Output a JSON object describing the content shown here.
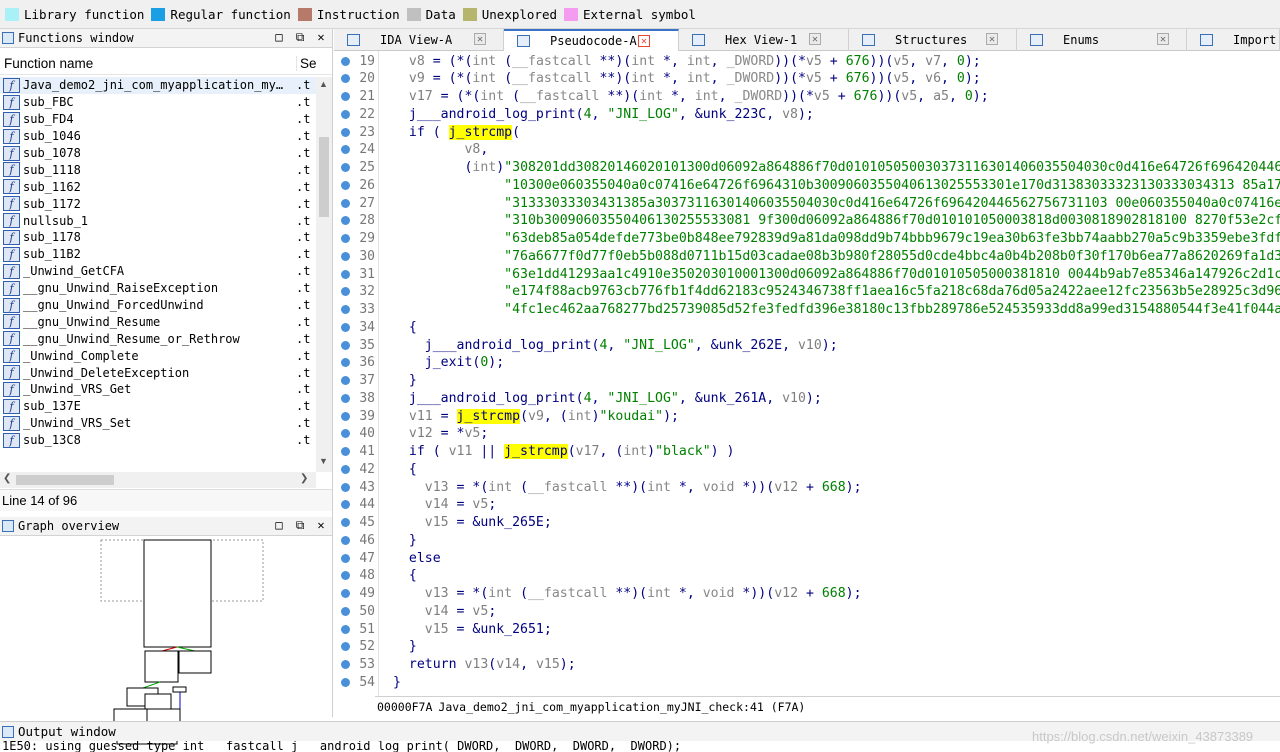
{
  "legend": [
    {
      "label": "Library function",
      "color": "#aaf0f7"
    },
    {
      "label": "Regular function",
      "color": "#1a9ee4"
    },
    {
      "label": "Instruction",
      "color": "#b57a6a"
    },
    {
      "label": "Data",
      "color": "#c0c0c0"
    },
    {
      "label": "Unexplored",
      "color": "#b5b56b"
    },
    {
      "label": "External symbol",
      "color": "#f49cf0"
    }
  ],
  "functions_window": {
    "title": "Functions window",
    "col_name": "Function name",
    "col_segment": "Se",
    "rows": [
      {
        "name": "Java_demo2_jni_com_myapplication_my…",
        "seg": ".t"
      },
      {
        "name": "sub_FBC",
        "seg": ".t"
      },
      {
        "name": "sub_FD4",
        "seg": ".t"
      },
      {
        "name": "sub_1046",
        "seg": ".t"
      },
      {
        "name": "sub_1078",
        "seg": ".t"
      },
      {
        "name": "sub_1118",
        "seg": ".t"
      },
      {
        "name": "sub_1162",
        "seg": ".t"
      },
      {
        "name": "sub_1172",
        "seg": ".t"
      },
      {
        "name": "nullsub_1",
        "seg": ".t"
      },
      {
        "name": "sub_1178",
        "seg": ".t"
      },
      {
        "name": "sub_11B2",
        "seg": ".t"
      },
      {
        "name": "_Unwind_GetCFA",
        "seg": ".t"
      },
      {
        "name": "__gnu_Unwind_RaiseException",
        "seg": ".t"
      },
      {
        "name": "__gnu_Unwind_ForcedUnwind",
        "seg": ".t"
      },
      {
        "name": "__gnu_Unwind_Resume",
        "seg": ".t"
      },
      {
        "name": "__gnu_Unwind_Resume_or_Rethrow",
        "seg": ".t"
      },
      {
        "name": "_Unwind_Complete",
        "seg": ".t"
      },
      {
        "name": "_Unwind_DeleteException",
        "seg": ".t"
      },
      {
        "name": "_Unwind_VRS_Get",
        "seg": ".t"
      },
      {
        "name": "sub_137E",
        "seg": ".t"
      },
      {
        "name": "_Unwind_VRS_Set",
        "seg": ".t"
      },
      {
        "name": "sub_13C8",
        "seg": ".t"
      }
    ],
    "line_count": "Line 14 of 96"
  },
  "graph_overview": {
    "title": "Graph overview"
  },
  "tabs": [
    {
      "label": "IDA View-A",
      "active": false
    },
    {
      "label": "Pseudocode-A",
      "active": true
    },
    {
      "label": "Hex View-1",
      "active": false
    },
    {
      "label": "Structures",
      "active": false
    },
    {
      "label": "Enums",
      "active": false
    },
    {
      "label": "Import",
      "active": false
    }
  ],
  "code_lines": [
    {
      "n": "19",
      "t": "  v8 = (*(int (__fastcall **)(int *, int, _DWORD))(*v5 + 676))(v5, v7, 0);"
    },
    {
      "n": "20",
      "t": "  v9 = (*(int (__fastcall **)(int *, int, _DWORD))(*v5 + 676))(v5, v6, 0);"
    },
    {
      "n": "21",
      "t": "  v17 = (*(int (__fastcall **)(int *, int, _DWORD))(*v5 + 676))(v5, a5, 0);"
    },
    {
      "n": "22",
      "t": "  j___android_log_print(4, \"JNI_LOG\", &unk_223C, v8);"
    },
    {
      "n": "23",
      "t": "  if ( j_strcmp("
    },
    {
      "n": "24",
      "t": "         v8,"
    },
    {
      "n": "25",
      "t": "         (int)\"308201dd30820146020101300d06092a864886f70d010105050030373116301406035504030c0d416e64726f6964204465"
    },
    {
      "n": "26",
      "t": "              \"10300e060355040a0c07416e64726f6964310b3009060355040613025553301e170d31383033323130333034313 85a170d"
    },
    {
      "n": "27",
      "t": "              \"31333033303431385a30373116301406035504030c0d416e64726f696420446562756731103 00e060355040a0c07416e647"
    },
    {
      "n": "28",
      "t": "              \"310b30090603550406130255533081 9f300d06092a864886f70d010101050003818d0030818902818100 8270f53e2cf8c7"
    },
    {
      "n": "29",
      "t": "              \"63deb85a054defde773be0b848ee792839d9a81da098dd9b74bbb9679c19ea30b63fe3bb74aabb270a5c9b3359ebe3fdf27"
    },
    {
      "n": "30",
      "t": "              \"76a6677f0d77f0eb5b088d0711b15d03cadae08b3b980f28055d0cde4bbc4a0b4b208b0f30f170b6ea77a8620269fa1d375"
    },
    {
      "n": "31",
      "t": "              \"63e1dd41293aa1c4910e350203010001300d06092a864886f70d01010505000381810 0044b9ab7e85346a147926c2d1c6c3"
    },
    {
      "n": "32",
      "t": "              \"e174f88acb9763cb776fb1f4dd62183c9524346738ff1aea16c5fa218c68da76d05a2422aee12fc23563b5e28925c3d96df"
    },
    {
      "n": "33",
      "t": "              \"4fc1ec462aa768277bd25739085d52fe3fedfd396e38180c13fbb289786e524535933dd8a99ed3154880544f3e41f044acc"
    },
    {
      "n": "34",
      "t": "  {"
    },
    {
      "n": "35",
      "t": "    j___android_log_print(4, \"JNI_LOG\", &unk_262E, v10);"
    },
    {
      "n": "36",
      "t": "    j_exit(0);"
    },
    {
      "n": "37",
      "t": "  }"
    },
    {
      "n": "38",
      "t": "  j___android_log_print(4, \"JNI_LOG\", &unk_261A, v10);"
    },
    {
      "n": "39",
      "t": "  v11 = j_strcmp(v9, (int)\"koudai\");"
    },
    {
      "n": "40",
      "t": "  v12 = *v5;"
    },
    {
      "n": "41",
      "t": "  if ( v11 || j_strcmp(v17, (int)\"black\") )"
    },
    {
      "n": "42",
      "t": "  {"
    },
    {
      "n": "43",
      "t": "    v13 = *(int (__fastcall **)(int *, void *))(v12 + 668);"
    },
    {
      "n": "44",
      "t": "    v14 = v5;"
    },
    {
      "n": "45",
      "t": "    v15 = &unk_265E;"
    },
    {
      "n": "46",
      "t": "  }"
    },
    {
      "n": "47",
      "t": "  else"
    },
    {
      "n": "48",
      "t": "  {"
    },
    {
      "n": "49",
      "t": "    v13 = *(int (__fastcall **)(int *, void *))(v12 + 668);"
    },
    {
      "n": "50",
      "t": "    v14 = v5;"
    },
    {
      "n": "51",
      "t": "    v15 = &unk_2651;"
    },
    {
      "n": "52",
      "t": "  }"
    },
    {
      "n": "53",
      "t": "  return v13(v14, v15);"
    },
    {
      "n": "54",
      "t": "}"
    }
  ],
  "status": {
    "address": "00000F7A",
    "location": "Java_demo2_jni_com_myapplication_myJNI_check:41 (F7A)"
  },
  "output": {
    "title": "Output window",
    "text": "1E50: using guessed type int __fastcall j___android_log_print(_DWORD, _DWORD, _DWORD, _DWORD);"
  },
  "watermark": "https://blog.csdn.net/weixin_43873389"
}
